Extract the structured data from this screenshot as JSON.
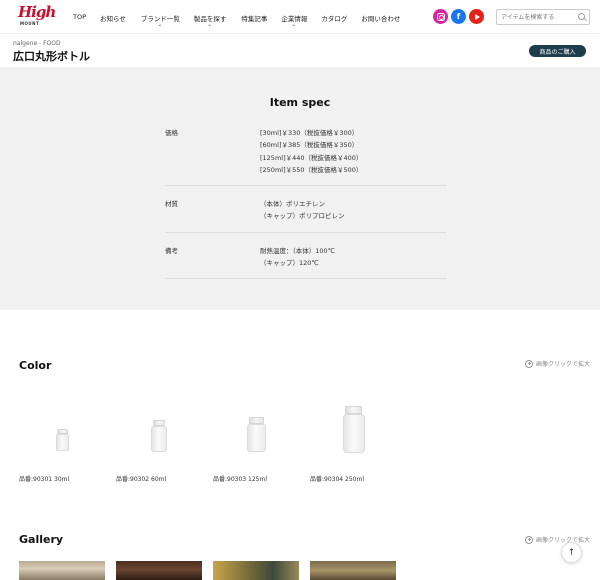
{
  "header": {
    "logo": {
      "text": "High",
      "sub": "MOUNT"
    },
    "nav": [
      {
        "label": "TOP",
        "has_dropdown": false
      },
      {
        "label": "お知らせ",
        "has_dropdown": false
      },
      {
        "label": "ブランド一覧",
        "has_dropdown": true
      },
      {
        "label": "製品を探す",
        "has_dropdown": true
      },
      {
        "label": "特集記事",
        "has_dropdown": false
      },
      {
        "label": "企業情報",
        "has_dropdown": true
      },
      {
        "label": "カタログ",
        "has_dropdown": false
      },
      {
        "label": "お問い合わせ",
        "has_dropdown": false
      }
    ],
    "social": [
      "instagram-icon",
      "facebook-icon",
      "youtube-icon"
    ],
    "search_placeholder": "アイテムを検索する"
  },
  "title_bar": {
    "breadcrumb": "nalgene - FOOD",
    "title": "広口丸形ボトル",
    "buy_button": "商品のご購入"
  },
  "spec": {
    "title": "Item spec",
    "rows": [
      {
        "label": "価格",
        "values": [
          "[30ml]￥330（税抜価格￥300）",
          "[60ml]￥385（税抜価格￥350）",
          "[125ml]￥440（税抜価格￥400）",
          "[250ml]￥550（税抜価格￥500）"
        ]
      },
      {
        "label": "材質",
        "values": [
          "（本体）ポリエチレン",
          "（キャップ）ポリプロピレン"
        ]
      },
      {
        "label": "備考",
        "values": [
          "耐熱温度：（本体）100℃",
          "（キャップ）120℃"
        ]
      }
    ]
  },
  "color": {
    "title": "Color",
    "zoom_hint": "画像クリックで拡大",
    "products": [
      {
        "label": "品番:90301 30ml"
      },
      {
        "label": "品番:90302 60ml"
      },
      {
        "label": "品番:90303 125ml"
      },
      {
        "label": "品番:90304 250ml"
      }
    ]
  },
  "gallery": {
    "title": "Gallery",
    "zoom_hint": "画像クリックで拡大"
  },
  "colors": {
    "buy_button_bg": "#1d3c4c",
    "logo_red": "#c8102e",
    "spec_bg": "#f1f1f1"
  }
}
